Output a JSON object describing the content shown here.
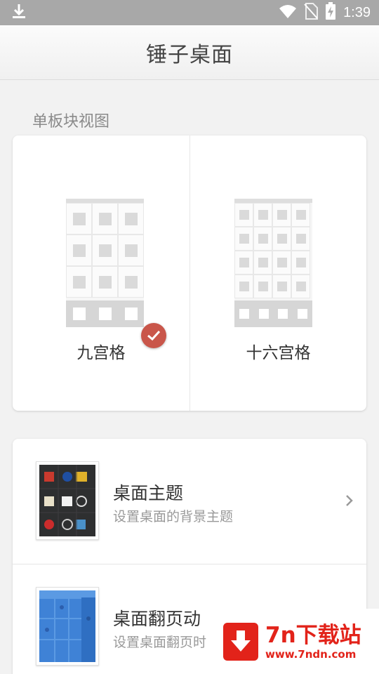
{
  "status_bar": {
    "time": "1:39",
    "icons": [
      "download-icon",
      "wifi-icon",
      "no-sim-icon",
      "battery-charging-icon"
    ]
  },
  "header": {
    "title": "锤子桌面"
  },
  "section": {
    "label": "单板块视图"
  },
  "grid_options": [
    {
      "label": "九宫格",
      "selected": true,
      "columns": 3,
      "rows": 3
    },
    {
      "label": "十六宫格",
      "selected": false,
      "columns": 4,
      "rows": 4
    }
  ],
  "settings": [
    {
      "title": "桌面主题",
      "subtitle": "设置桌面的背景主题",
      "icon": "theme-thumbnail-icon"
    },
    {
      "title": "桌面翻页动",
      "subtitle": "设置桌面翻页时",
      "icon": "page-flip-thumbnail-icon"
    }
  ],
  "watermark": {
    "name": "7n下载站",
    "url": "www.7ndn.com"
  },
  "colors": {
    "accent_check": "#c9564a",
    "watermark_red": "#e2231a",
    "status_bar": "#a8a8a8"
  }
}
